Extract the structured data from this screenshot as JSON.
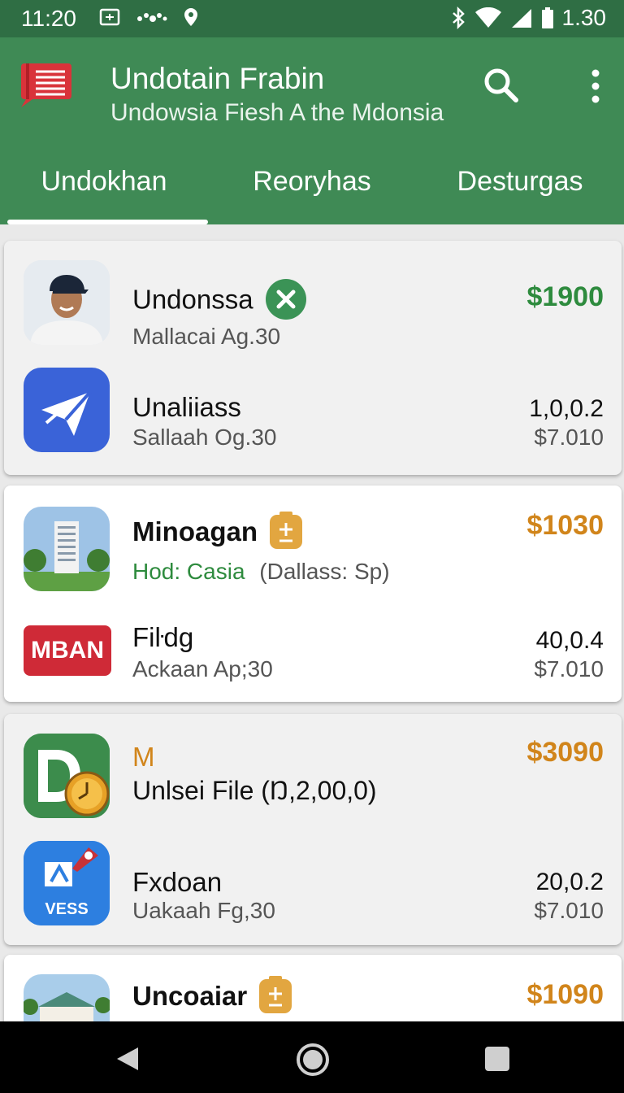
{
  "status_bar": {
    "time": "11:20",
    "right_text": "1.30",
    "icons": [
      "screen-cast-icon",
      "dots-icon",
      "location-icon",
      "bluetooth-icon",
      "wifi-icon",
      "signal-icon",
      "battery-icon"
    ]
  },
  "app_bar": {
    "title": "Undotain Frabin",
    "subtitle": "Undowsia Fiesh A the Mdonsia",
    "icons": [
      "list-logo-icon",
      "search-icon",
      "more-vert-icon"
    ]
  },
  "tabs": [
    {
      "label": "Undokhan",
      "active": true
    },
    {
      "label": "Reoryhas",
      "active": false
    },
    {
      "label": "Desturgas",
      "active": false
    }
  ],
  "cards": [
    {
      "rows": [
        {
          "title": "Undonssa",
          "subtitle": "Mallacai Ag.30",
          "amount": "$1900",
          "badge": "close-circle-icon"
        },
        {
          "title": "Unaliiass",
          "subtitle": "Sallaah Og.30",
          "value": "1,0,0.2",
          "sub_value": "$7.010"
        }
      ]
    },
    {
      "rows": [
        {
          "title": "Minoagan",
          "subtitle": "Hod: Casia",
          "subtitle_extra": "(Dallass: Sp)",
          "amount": "$1030",
          "badge": "plus-minus-badge-icon"
        },
        {
          "title": "Fiŀdg",
          "subtitle": "Ackaan Ap;30",
          "value": "40,0.4",
          "sub_value": "$7.010",
          "logo_text": "MBAN"
        }
      ]
    },
    {
      "rows": [
        {
          "title": "M",
          "subtitle": "Unlsei File (Ŋ,2,00,0)",
          "amount": "$3090"
        },
        {
          "title": "Fxdoan",
          "subtitle": "Uakaah Fg,30",
          "value": "20,0.2",
          "sub_value": "$7.010",
          "logo_text": "VESS"
        }
      ]
    },
    {
      "rows": [
        {
          "title": "Uncoaiar",
          "amount": "$1090",
          "badge": "plus-minus-badge-icon"
        }
      ]
    }
  ],
  "nav_bar": {
    "icons": [
      "back-icon",
      "home-icon",
      "recents-icon"
    ]
  },
  "colors": {
    "status_bar": "#2f6e44",
    "app_bar": "#3f8a55",
    "green_amount": "#2e8b3e",
    "orange_amount": "#d1851b"
  }
}
